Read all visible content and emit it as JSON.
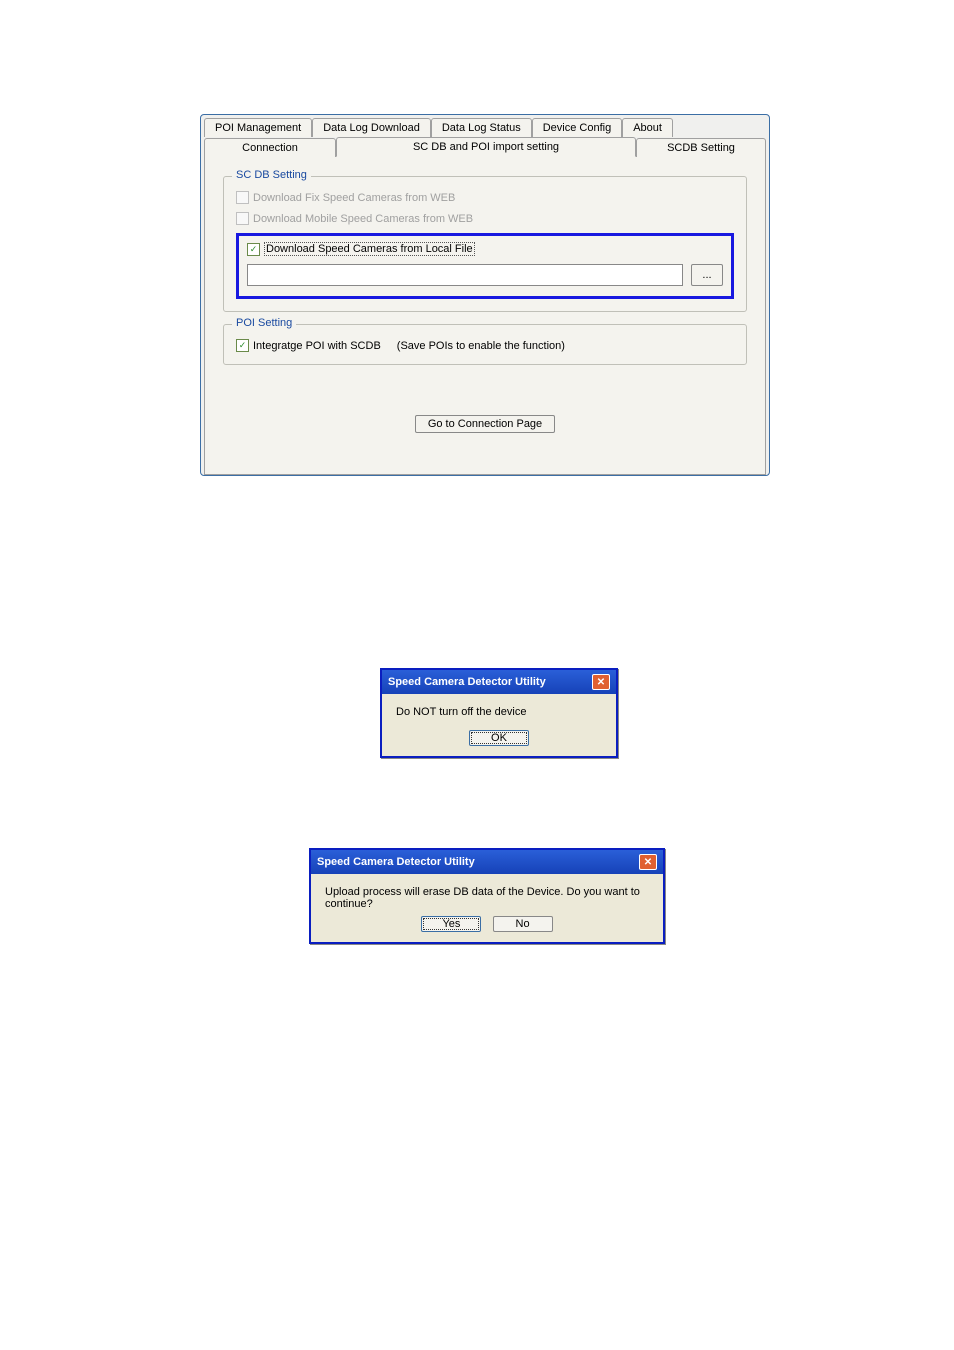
{
  "tabs_row1": {
    "poi_management": "POI Management",
    "data_log_download": "Data Log Download",
    "data_log_status": "Data Log Status",
    "device_config": "Device Config",
    "about": "About"
  },
  "tabs_row2": {
    "connection": "Connection",
    "scdb_poi_import": "SC DB and POI import setting",
    "scdb_setting": "SCDB  Setting"
  },
  "scdb_group": {
    "title": "SC DB  Setting",
    "chk_fix": "Download Fix Speed Cameras from WEB",
    "chk_mobile": "Download Mobile Speed Cameras from WEB",
    "chk_local": "Download  Speed Cameras from Local File",
    "file_value": "",
    "browse": "..."
  },
  "poi_group": {
    "title": "POI Setting",
    "chk_integrate": "Integratge  POI with SCDB",
    "hint": "(Save POIs to enable the function)"
  },
  "go_button": "Go to Connection Page",
  "dialog1": {
    "title": "Speed Camera Detector Utility",
    "message": "Do NOT turn off the device",
    "ok": "OK"
  },
  "dialog2": {
    "title": "Speed Camera Detector Utility",
    "message": "Upload process will erase DB data of the Device. Do you want to continue?",
    "yes": "Yes",
    "no": "No"
  }
}
